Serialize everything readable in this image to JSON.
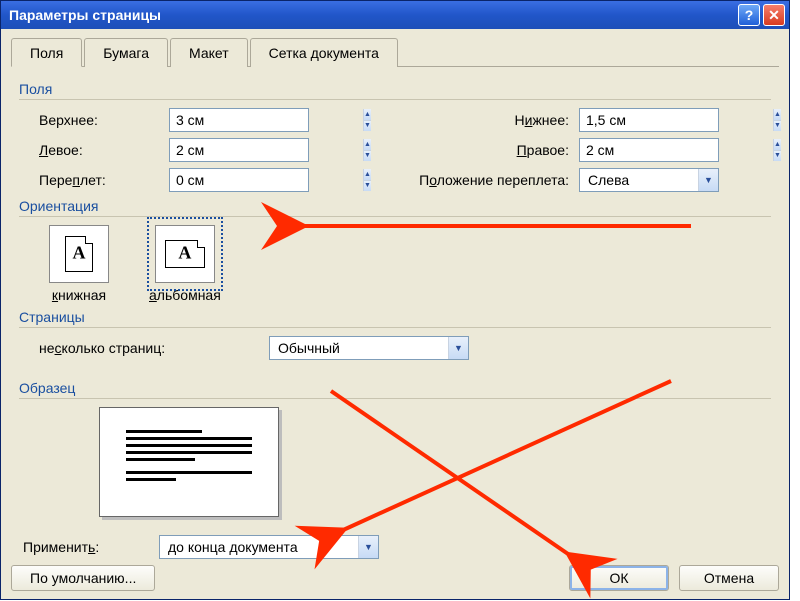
{
  "titlebar": {
    "title": "Параметры страницы"
  },
  "tabs": {
    "fields": "Поля",
    "paper": "Бумага",
    "layout": "Макет",
    "grid": "Сетка документа"
  },
  "groups": {
    "fields": "Поля",
    "orientation": "Ориентация",
    "pages": "Страницы",
    "sample": "Образец"
  },
  "margins": {
    "top_label": "Верхнее:",
    "top_value": "3 см",
    "bottom_label_pre": "Н",
    "bottom_label_u": "и",
    "bottom_label_post": "жнее:",
    "bottom_value": "1,5 см",
    "left_label_pre": "",
    "left_label_u": "Л",
    "left_label_post": "евое:",
    "left_value": "2 см",
    "right_label_pre": "",
    "right_label_u": "П",
    "right_label_post": "равое:",
    "right_value": "2 см",
    "gutter_label": "Пере",
    "gutter_label_u": "п",
    "gutter_label_post": "лет:",
    "gutter_value": "0 см",
    "gutter_pos_label_pre": "П",
    "gutter_pos_label_u": "о",
    "gutter_pos_label_post": "ложение переплета:",
    "gutter_pos_value": "Слева"
  },
  "orientation": {
    "portrait_pre": "",
    "portrait_u": "к",
    "portrait_post": "нижная",
    "landscape_pre": "",
    "landscape_u": "а",
    "landscape_post": "льбомная"
  },
  "pages": {
    "multi_label": "не",
    "multi_label_u": "с",
    "multi_label_post": "колько страниц:",
    "multi_value": "Обычный"
  },
  "apply": {
    "label": "Применит",
    "label_u": "ь",
    "label_post": ":",
    "value": "до конца документа"
  },
  "buttons": {
    "default": "По умолчанию...",
    "ok": "ОК",
    "cancel": "Отмена"
  }
}
